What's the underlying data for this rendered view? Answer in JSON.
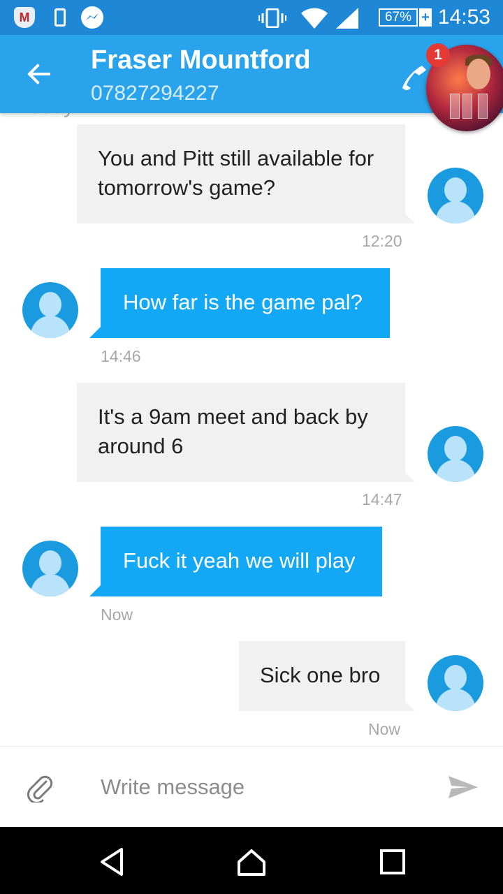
{
  "status_bar": {
    "time": "14:53",
    "battery": "67%",
    "battery_plus": "+",
    "icons": [
      "mcafee-icon",
      "phone-sync-icon",
      "messenger-icon",
      "vibrate-icon",
      "wifi-icon",
      "signal-icon",
      "battery-icon"
    ],
    "mcafee_letter": "M"
  },
  "header": {
    "contact_name": "Fraser Mountford",
    "phone_number": "07827294227",
    "notification_count": "1",
    "color": "#29a3ec"
  },
  "conversation": {
    "day_label": "Today",
    "messages": [
      {
        "direction": "incoming",
        "text": "You and Pitt still available for tomorrow's game?",
        "time": "12:20"
      },
      {
        "direction": "outgoing",
        "text": "How far is the game pal?",
        "time": "14:46"
      },
      {
        "direction": "incoming",
        "text": "It's a 9am meet and back by around 6",
        "time": "14:47"
      },
      {
        "direction": "outgoing",
        "text": "Fuck it yeah we will play",
        "time": "Now"
      },
      {
        "direction": "incoming",
        "text": "Sick one bro",
        "time": "Now"
      }
    ]
  },
  "composer": {
    "placeholder": "Write message",
    "value": ""
  },
  "colors": {
    "status_bar": "#1e88d6",
    "outgoing_bubble": "#12a8f6",
    "incoming_bubble": "#f1f1f1",
    "avatar": "#1a9be0"
  }
}
